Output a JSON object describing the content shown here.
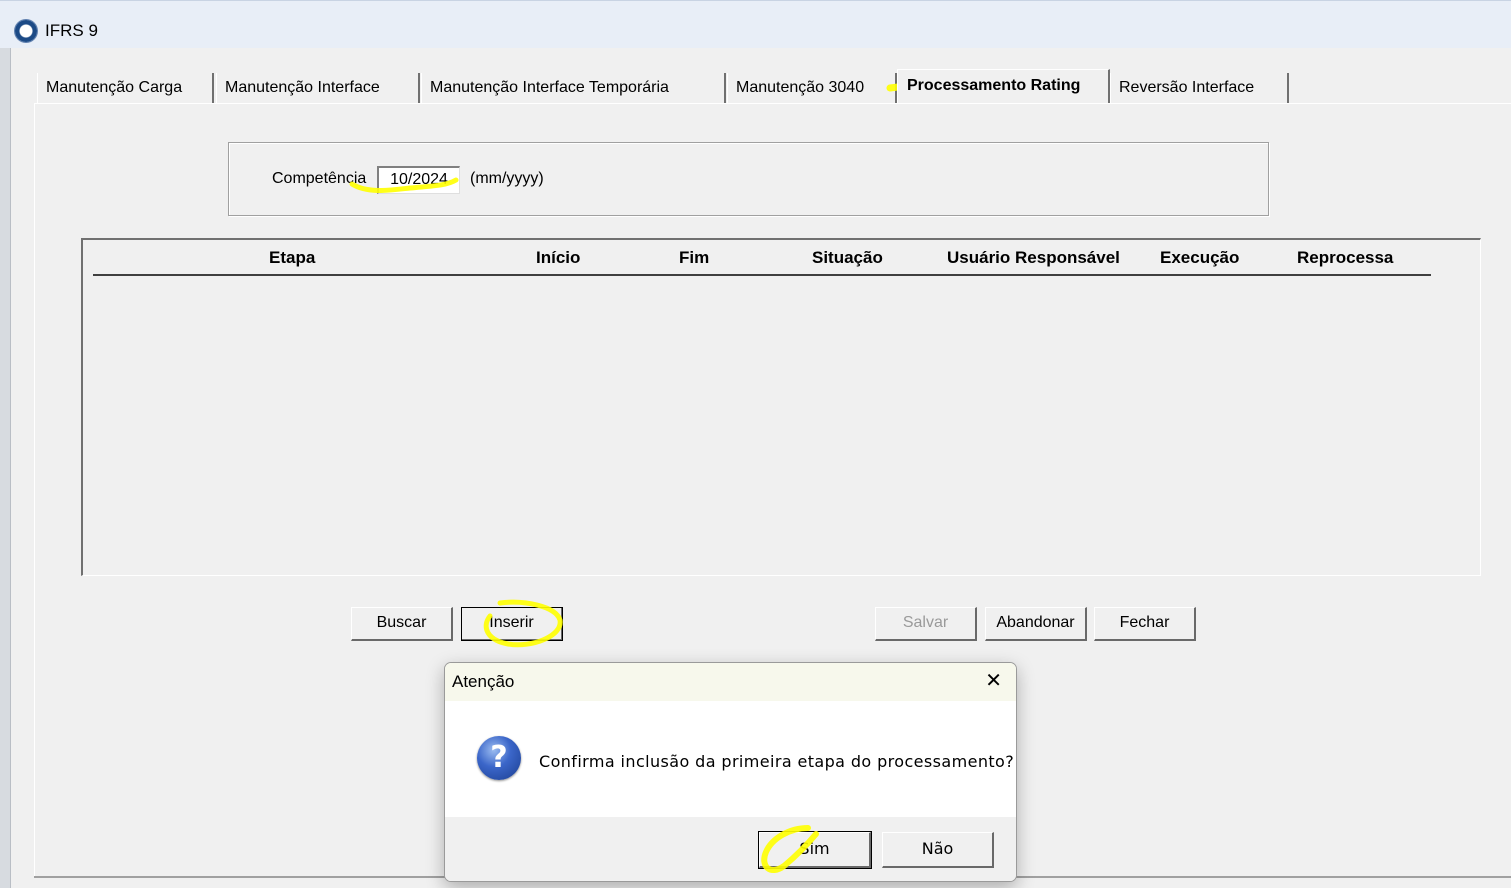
{
  "window": {
    "title": "IFRS 9"
  },
  "tabs": [
    {
      "label": "Manutenção Carga"
    },
    {
      "label": "Manutenção Interface"
    },
    {
      "label": "Manutenção Interface Temporária"
    },
    {
      "label": "Manutenção 3040"
    },
    {
      "label": "Processamento Rating",
      "active": true
    },
    {
      "label": "Reversão Interface"
    }
  ],
  "form": {
    "competencia_label": "Competência",
    "competencia_value": "10/2024",
    "format_hint": "(mm/yyyy)"
  },
  "grid": {
    "columns": [
      "Etapa",
      "Início",
      "Fim",
      "Situação",
      "Usuário Responsável",
      "Execução",
      "Reprocessa"
    ],
    "rows": []
  },
  "buttons": {
    "buscar": "Buscar",
    "inserir": "Inserir",
    "salvar": "Salvar",
    "abandonar": "Abandonar",
    "fechar": "Fechar"
  },
  "dialog": {
    "title": "Atenção",
    "message": "Confirma inclusão da primeira etapa do processamento?",
    "icon": "question-icon",
    "close_glyph": "✕",
    "question_glyph": "?",
    "yes": "Sim",
    "no": "Não"
  },
  "colors": {
    "highlight": "#ffff00",
    "title_bar": "#e8eef7",
    "dialog_title_bar": "#f7f8ec"
  }
}
